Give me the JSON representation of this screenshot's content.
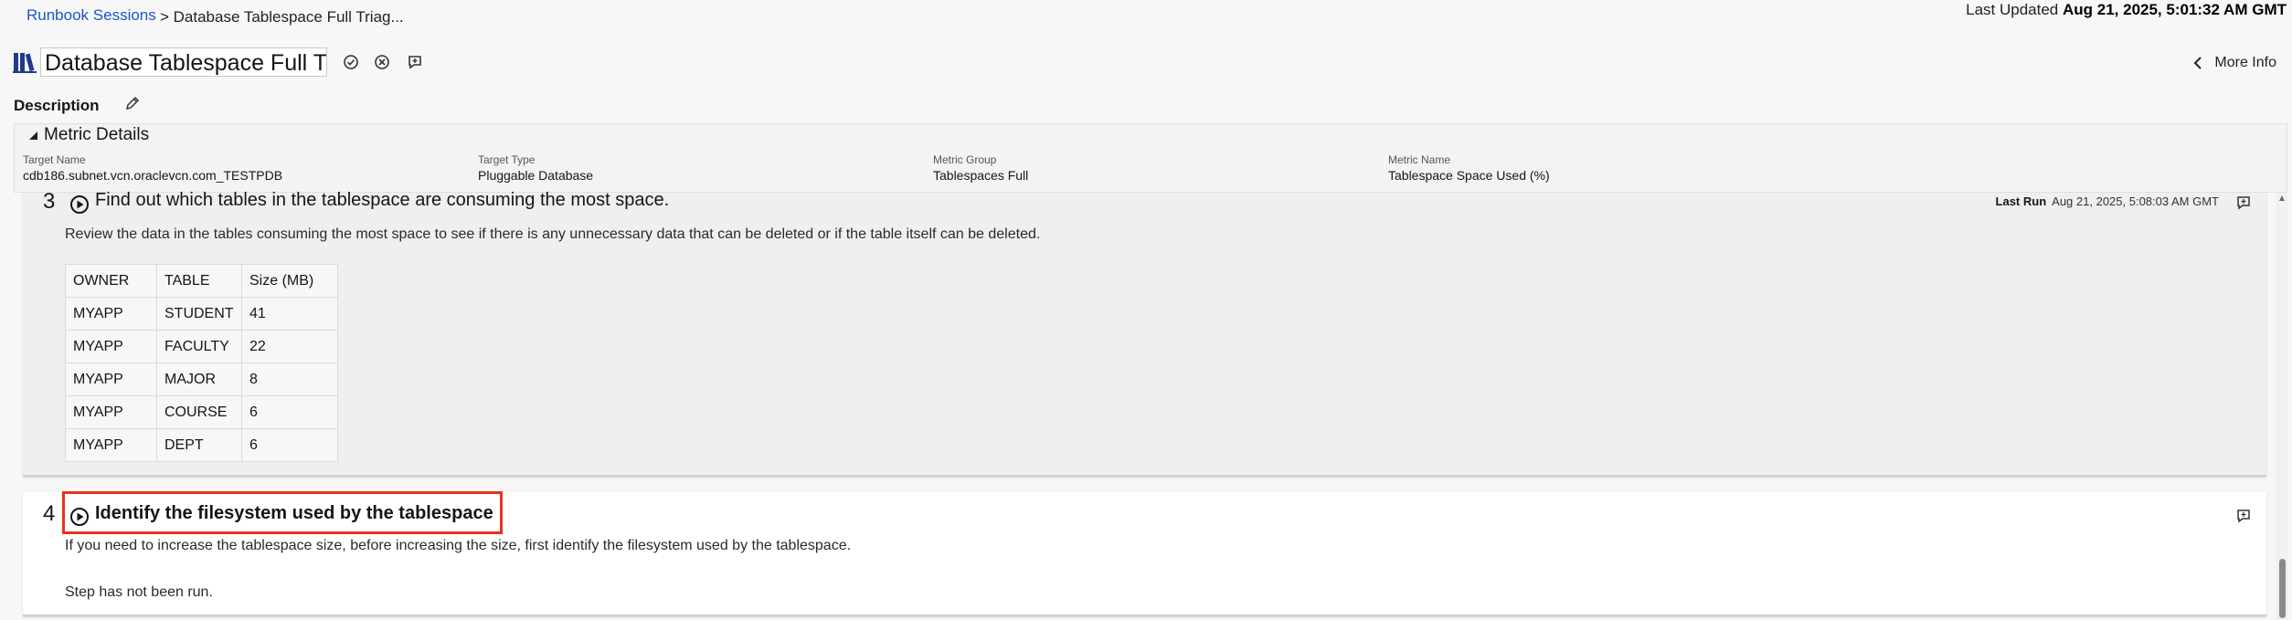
{
  "breadcrumb": {
    "link": "Runbook Sessions",
    "current": "> Database Tablespace Full Triag..."
  },
  "last_updated": {
    "label": "Last Updated",
    "value": "Aug 21, 2025, 5:01:32 AM GMT"
  },
  "header": {
    "title": "Database Tablespace Full Triage",
    "more_info": "More Info"
  },
  "description": {
    "label": "Description"
  },
  "metric_details": {
    "title": "Metric Details",
    "fields": [
      {
        "label": "Target Name",
        "value": "cdb186.subnet.vcn.oraclevcn.com_TESTPDB"
      },
      {
        "label": "Target Type",
        "value": "Pluggable Database"
      },
      {
        "label": "Metric Group",
        "value": "Tablespaces Full"
      },
      {
        "label": "Metric Name",
        "value": "Tablespace Space Used (%)"
      }
    ]
  },
  "steps": [
    {
      "number": "3",
      "title": "Find out which tables in the tablespace are consuming the most space.",
      "description": "Review the data in the tables consuming the most space to see if there is any unnecessary data that can be deleted or if the table itself can be deleted.",
      "last_run_label": "Last Run",
      "last_run_value": "Aug 21, 2025, 5:08:03 AM GMT",
      "table": {
        "headers": [
          "OWNER",
          "TABLE",
          "Size (MB)"
        ],
        "rows": [
          [
            "MYAPP",
            "STUDENT",
            "41"
          ],
          [
            "MYAPP",
            "FACULTY",
            "22"
          ],
          [
            "MYAPP",
            "MAJOR",
            "8"
          ],
          [
            "MYAPP",
            "COURSE",
            "6"
          ],
          [
            "MYAPP",
            "DEPT",
            "6"
          ]
        ]
      }
    },
    {
      "number": "4",
      "title": "Identify the filesystem used by the tablespace",
      "description": "If you need to increase the tablespace size, before increasing the size, first identify the filesystem used by the tablespace.",
      "status": "Step has not been run."
    }
  ],
  "colors": {
    "link": "#1a55c8",
    "highlight": "#e8321e",
    "title_icon": "#1f3b8a"
  }
}
